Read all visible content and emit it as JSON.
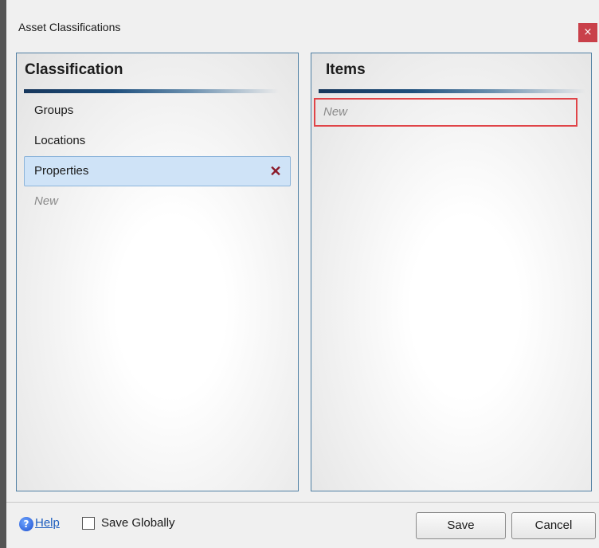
{
  "window": {
    "title": "Asset Classifications",
    "close_glyph": "×"
  },
  "classification": {
    "header": "Classification",
    "items": [
      {
        "label": "Groups"
      },
      {
        "label": "Locations"
      },
      {
        "label": "Properties",
        "selected": true,
        "delete_glyph": "✕"
      }
    ],
    "new_placeholder": "New"
  },
  "items_panel": {
    "header": "Items",
    "new_placeholder": "New"
  },
  "footer": {
    "help_glyph": "?",
    "help_label": "Help",
    "save_globally_label": "Save Globally",
    "save_globally_checked": false,
    "save_label": "Save",
    "cancel_label": "Cancel"
  },
  "colors": {
    "close_button": "#c9404a",
    "selected_row": "#cfe3f7",
    "delete_icon": "#8b1a2a",
    "items_new_border": "#e04448",
    "help_link": "#1f5fbf"
  },
  "icons": [
    "close-icon",
    "delete-icon",
    "help-icon",
    "checkbox-icon"
  ]
}
